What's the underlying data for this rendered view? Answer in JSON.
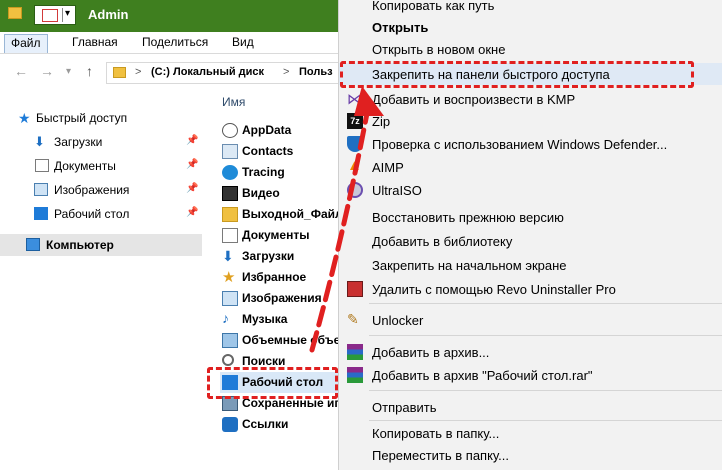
{
  "window": {
    "title": "Admin"
  },
  "ribbon": {
    "tabs": [
      "Файл",
      "Главная",
      "Поделиться",
      "Вид"
    ]
  },
  "address": {
    "segments": [
      "(C:) Локальный диск",
      "Польз"
    ],
    "separator": ">"
  },
  "navpane": {
    "items": [
      {
        "label": "Быстрый доступ",
        "icon": "star-icon"
      },
      {
        "label": "Загрузки",
        "icon": "downloads-icon",
        "pinned": true
      },
      {
        "label": "Документы",
        "icon": "documents-icon",
        "pinned": true
      },
      {
        "label": "Изображения",
        "icon": "pictures-icon",
        "pinned": true
      },
      {
        "label": "Рабочий стол",
        "icon": "desktop-icon",
        "pinned": true
      },
      {
        "label": "Компьютер",
        "icon": "computer-icon",
        "selected": true
      }
    ]
  },
  "content": {
    "column_header": "Имя",
    "files": [
      {
        "label": "AppData",
        "icon": "appdata-icon"
      },
      {
        "label": "Contacts",
        "icon": "contacts-icon"
      },
      {
        "label": "Tracing",
        "icon": "tracing-icon"
      },
      {
        "label": "Видео",
        "icon": "video-icon"
      },
      {
        "label": "Выходной_Файл",
        "icon": "folder-icon"
      },
      {
        "label": "Документы",
        "icon": "documents-icon"
      },
      {
        "label": "Загрузки",
        "icon": "downloads-icon"
      },
      {
        "label": "Избранное",
        "icon": "favorites-icon"
      },
      {
        "label": "Изображения",
        "icon": "pictures-icon"
      },
      {
        "label": "Музыка",
        "icon": "music-icon"
      },
      {
        "label": "Объемные объе",
        "icon": "3d-objects-icon"
      },
      {
        "label": "Поиски",
        "icon": "search-icon"
      },
      {
        "label": "Рабочий стол",
        "icon": "desktop-icon",
        "highlighted": true
      },
      {
        "label": "Сохраненные иг",
        "icon": "saved-games-icon"
      },
      {
        "label": "Ссылки",
        "icon": "links-icon"
      }
    ]
  },
  "context_menu": {
    "items": [
      {
        "label": "Копировать как путь"
      },
      {
        "label": "Открыть",
        "bold": true
      },
      {
        "label": "Открыть в новом окне"
      },
      {
        "label": "Закрепить на панели быстрого доступа",
        "highlighted": true
      },
      {
        "label": "Добавить и воспроизвести в KMP",
        "icon": "kmp-icon"
      },
      {
        "label": "Zip",
        "icon": "7zip-icon"
      },
      {
        "label": "Проверка с использованием Windows Defender...",
        "icon": "defender-icon"
      },
      {
        "label": "AIMP",
        "icon": "aimp-icon"
      },
      {
        "label": "UltraISO",
        "icon": "ultraiso-icon"
      },
      {
        "label": "Восстановить прежнюю версию"
      },
      {
        "label": "Добавить в библиотеку"
      },
      {
        "label": "Закрепить на начальном экране"
      },
      {
        "label": "Удалить с помощью Revo Uninstaller Pro",
        "icon": "revo-icon"
      },
      {
        "label": "Unlocker",
        "icon": "unlocker-icon"
      },
      {
        "label": "Добавить в архив...",
        "icon": "winrar-icon"
      },
      {
        "label": "Добавить в архив \"Рабочий стол.rar\"",
        "icon": "winrar-icon"
      },
      {
        "label": "Отправить"
      },
      {
        "label": "Копировать в папку..."
      },
      {
        "label": "Переместить в папку..."
      }
    ]
  },
  "colors": {
    "titlebar": "#3f7f1f",
    "annotation_red": "#e02020",
    "menu_bg": "#f2f2f2"
  }
}
